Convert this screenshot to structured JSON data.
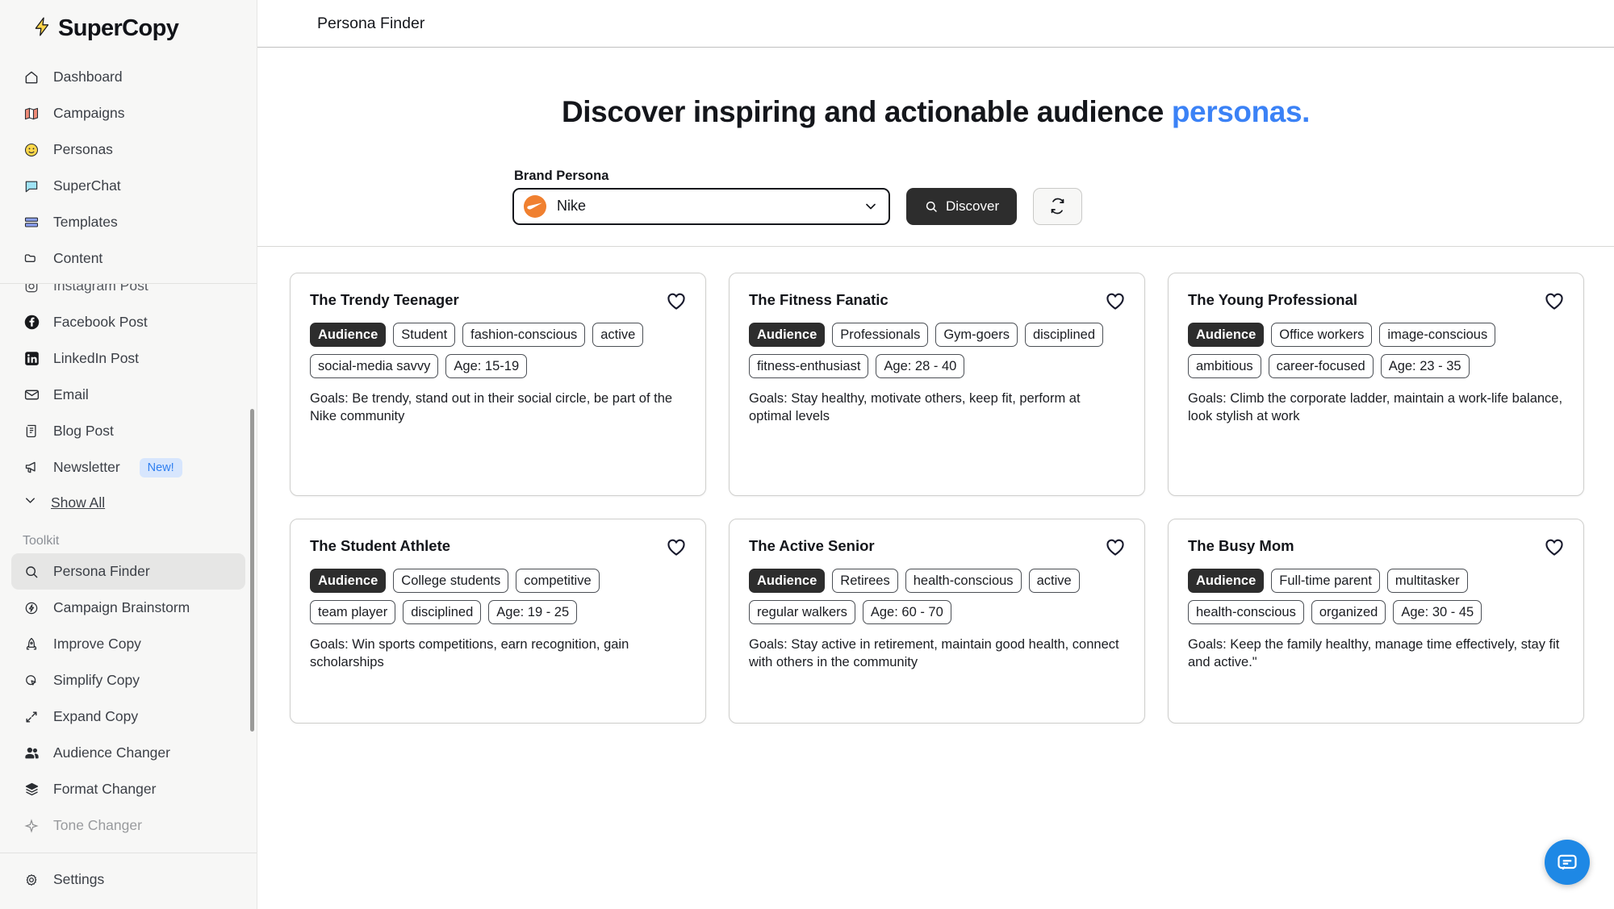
{
  "brand": {
    "name": "SuperCopy",
    "bolt_icon": "lightning-bolt-icon"
  },
  "sidebar": {
    "top_items": [
      {
        "label": "Dashboard",
        "icon": "home-icon"
      },
      {
        "label": "Campaigns",
        "icon": "map-icon"
      },
      {
        "label": "Personas",
        "icon": "smiley-icon"
      },
      {
        "label": "SuperChat",
        "icon": "chat-bubble-icon"
      },
      {
        "label": "Templates",
        "icon": "layout-rows-icon"
      },
      {
        "label": "Content",
        "icon": "folder-icon"
      }
    ],
    "scroll_items": [
      {
        "label": "Facebook Post",
        "icon": "facebook-icon"
      },
      {
        "label": "LinkedIn Post",
        "icon": "linkedin-icon"
      },
      {
        "label": "Email",
        "icon": "envelope-icon"
      },
      {
        "label": "Blog Post",
        "icon": "scroll-document-icon"
      },
      {
        "label": "Newsletter",
        "icon": "megaphone-icon",
        "badge": "New!"
      }
    ],
    "show_all": {
      "label": "Show All",
      "icon": "chevron-down-icon"
    },
    "toolkit_label": "Toolkit",
    "toolkit_items": [
      {
        "label": "Persona Finder",
        "icon": "search-icon",
        "active": true
      },
      {
        "label": "Campaign Brainstorm",
        "icon": "bolt-circle-icon"
      },
      {
        "label": "Improve Copy",
        "icon": "rocket-icon"
      },
      {
        "label": "Simplify Copy",
        "icon": "cursor-click-icon"
      },
      {
        "label": "Expand Copy",
        "icon": "expand-arrows-icon"
      },
      {
        "label": "Audience Changer",
        "icon": "users-icon"
      },
      {
        "label": "Format Changer",
        "icon": "layers-icon"
      }
    ],
    "settings": {
      "label": "Settings",
      "icon": "gear-icon"
    }
  },
  "topbar": {
    "title": "Persona Finder"
  },
  "hero": {
    "headline_main": "Discover inspiring and actionable audience ",
    "headline_accent": "personas.",
    "accent_color": "#3b82f6"
  },
  "controls": {
    "field_label": "Brand Persona",
    "selected_brand": "Nike",
    "brand_logo_icon": "nike-swoosh-icon",
    "brand_logo_color": "#f08030",
    "chevron_icon": "chevron-down-icon",
    "discover_label": "Discover",
    "discover_icon": "search-icon",
    "refresh_icon": "refresh-icon"
  },
  "cards": [
    {
      "title": "The Trendy Teenager",
      "favorite_icon": "heart-icon",
      "tags": [
        "Audience",
        "Student",
        "fashion-conscious",
        "active",
        "social-media savvy",
        "Age: 15-19"
      ],
      "goals": "Goals: Be trendy, stand out in their social circle, be part of the Nike community"
    },
    {
      "title": "The Fitness Fanatic",
      "favorite_icon": "heart-icon",
      "tags": [
        "Audience",
        "Professionals",
        "Gym-goers",
        "disciplined",
        "fitness-enthusiast",
        "Age: 28 - 40"
      ],
      "goals": "Goals: Stay healthy, motivate others, keep fit, perform at optimal levels"
    },
    {
      "title": "The Young Professional",
      "favorite_icon": "heart-icon",
      "tags": [
        "Audience",
        "Office workers",
        "image-conscious",
        "ambitious",
        "career-focused",
        "Age: 23 - 35"
      ],
      "goals": "Goals: Climb the corporate ladder, maintain a work-life balance, look stylish at work"
    },
    {
      "title": "The Student Athlete",
      "favorite_icon": "heart-icon",
      "tags": [
        "Audience",
        "College students",
        "competitive",
        "team player",
        "disciplined",
        "Age: 19 - 25"
      ],
      "goals": "Goals: Win sports competitions, earn recognition, gain scholarships"
    },
    {
      "title": "The Active Senior",
      "favorite_icon": "heart-icon",
      "tags": [
        "Audience",
        "Retirees",
        "health-conscious",
        "active",
        "regular walkers",
        "Age: 60 - 70"
      ],
      "goals": "Goals: Stay active in retirement, maintain good health, connect with others in the community"
    },
    {
      "title": "The Busy Mom",
      "favorite_icon": "heart-icon",
      "tags": [
        "Audience",
        "Full-time parent",
        "multitasker",
        "health-conscious",
        "organized",
        "Age: 30 - 45"
      ],
      "goals": "Goals: Keep the family healthy, manage time effectively, stay fit and active.\""
    }
  ],
  "support": {
    "icon": "chat-support-icon",
    "color": "#1e88e5"
  }
}
